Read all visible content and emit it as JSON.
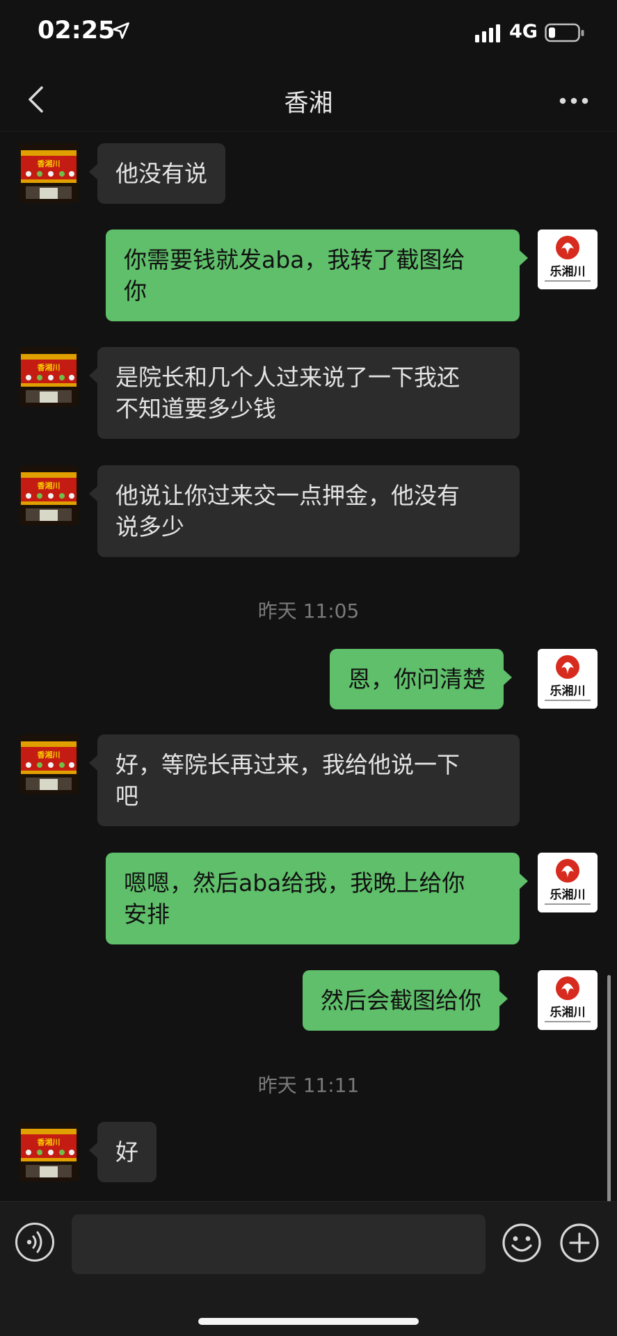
{
  "status_bar": {
    "time": "02:25",
    "network": "4G",
    "icons": [
      "location-arrow-icon",
      "signal-bars-icon",
      "battery-icon"
    ]
  },
  "nav": {
    "title": "香湘",
    "icons": [
      "back-chevron-icon",
      "more-dots-icon"
    ]
  },
  "messages": [
    {
      "sender": "contact",
      "text": "他没有说"
    },
    {
      "sender": "me",
      "text": "你需要钱就发aba，我转了截图给\n你"
    },
    {
      "sender": "contact",
      "text": "是院长和几个人过来说了一下我还\n不知道要多少钱"
    },
    {
      "sender": "contact",
      "text": "他说让你过来交一点押金，他没有\n说多少"
    },
    {
      "type": "time",
      "text": "昨天 11:05"
    },
    {
      "sender": "me",
      "text": "恩，你问清楚"
    },
    {
      "sender": "contact",
      "text": "好，等院长再过来，我给他说一下\n吧"
    },
    {
      "sender": "me",
      "text": "嗯嗯，然后aba给我，我晚上给你\n安排"
    },
    {
      "sender": "me",
      "text": "然后会截图给你"
    },
    {
      "type": "time",
      "text": "昨天 11:11"
    },
    {
      "sender": "contact",
      "text": "好"
    }
  ],
  "avatars": {
    "contact": {
      "kind": "restaurant storefront photo",
      "sign_text": "香湘川"
    },
    "me": {
      "kind": "logo",
      "logo_text": "乐湘川"
    }
  },
  "input_bar": {
    "icons": [
      "voice-wave-icon",
      "emoji-smile-icon",
      "plus-circle-icon"
    ]
  },
  "colors": {
    "background": "#121212",
    "incoming_bubble": "#2c2c2c",
    "outgoing_bubble": "#5fbf6a",
    "timestamp_text": "#7b7b7b"
  }
}
